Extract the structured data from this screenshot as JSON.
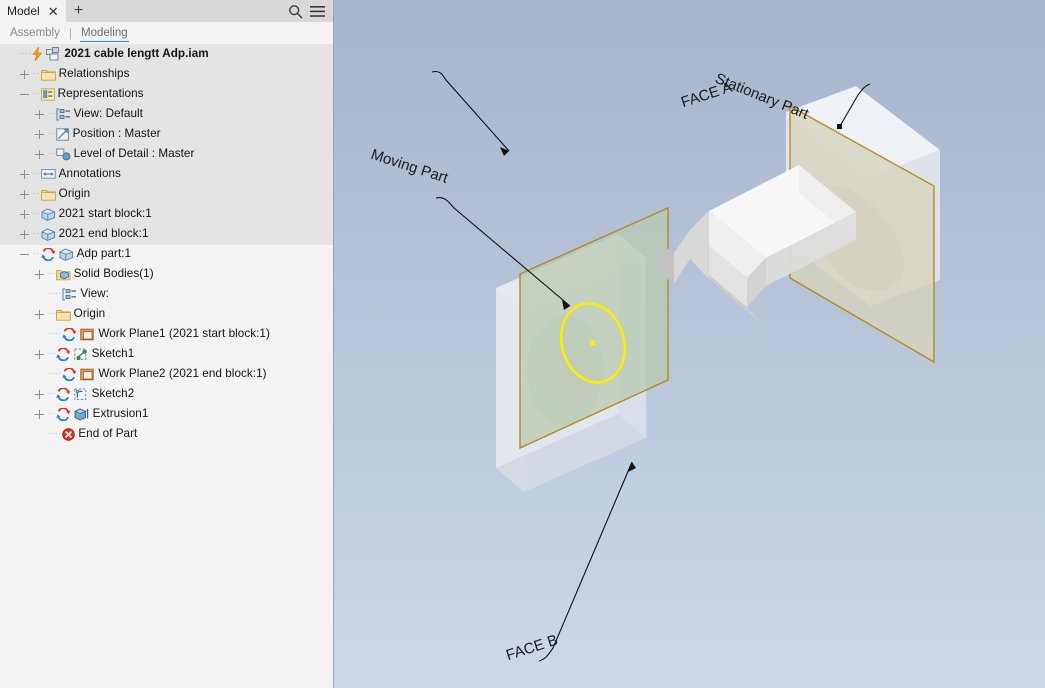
{
  "window": {
    "tab_title": "Model",
    "close_label": "✕",
    "add_label": "+",
    "search_icon": "search-icon",
    "menu_icon": "hamburger-menu-icon"
  },
  "subtabs": {
    "separator": "|",
    "items": [
      {
        "label": "Assembly",
        "active": false
      },
      {
        "label": "Modeling",
        "active": true
      }
    ]
  },
  "tree": {
    "rows": [
      {
        "label": "2021 cable lengtt Adp.iam",
        "indent": 0,
        "expander": "none",
        "icon": "assembly-icon",
        "bold": true,
        "lightning": true
      },
      {
        "label": "Relationships",
        "indent": 1,
        "expander": "plus",
        "icon": "folder-icon"
      },
      {
        "label": "Representations",
        "indent": 1,
        "expander": "minus",
        "icon": "representations-icon"
      },
      {
        "label": "View: Default",
        "indent": 2,
        "expander": "plus",
        "icon": "view-representation-icon"
      },
      {
        "label": "Position : Master",
        "indent": 2,
        "expander": "plus",
        "icon": "position-representation-icon"
      },
      {
        "label": "Level of Detail : Master",
        "indent": 2,
        "expander": "plus",
        "icon": "lod-representation-icon"
      },
      {
        "label": "Annotations",
        "indent": 1,
        "expander": "plus",
        "icon": "annotations-icon"
      },
      {
        "label": "Origin",
        "indent": 1,
        "expander": "plus",
        "icon": "folder-icon"
      },
      {
        "label": "2021 start block:1",
        "indent": 1,
        "expander": "plus",
        "icon": "part-icon"
      },
      {
        "label": "2021 end block:1",
        "indent": 1,
        "expander": "plus",
        "icon": "part-icon"
      },
      {
        "label": "Adp part:1",
        "indent": 1,
        "expander": "minus",
        "icon": "part-icon",
        "adaptive": true
      },
      {
        "label": "Solid Bodies(1)",
        "indent": 2,
        "expander": "plus",
        "icon": "solid-bodies-icon"
      },
      {
        "label": "View:",
        "indent": 2,
        "expander": "none",
        "icon": "view-representation-icon"
      },
      {
        "label": "Origin",
        "indent": 2,
        "expander": "plus",
        "icon": "folder-icon"
      },
      {
        "label": "Work Plane1 (2021 start block:1)",
        "indent": 2,
        "expander": "none",
        "icon": "work-plane-icon",
        "adaptive": true
      },
      {
        "label": "Sketch1",
        "indent": 2,
        "expander": "plus",
        "icon": "sketch-icon",
        "adaptive": true
      },
      {
        "label": "Work Plane2 (2021 end block:1)",
        "indent": 2,
        "expander": "none",
        "icon": "work-plane-icon",
        "adaptive": true
      },
      {
        "label": "Sketch2",
        "indent": 2,
        "expander": "plus",
        "icon": "sketch2-icon",
        "adaptive": true
      },
      {
        "label": "Extrusion1",
        "indent": 2,
        "expander": "plus",
        "icon": "extrusion-icon",
        "adaptive": true
      },
      {
        "label": "End of Part",
        "indent": 2,
        "expander": "none",
        "icon": "end-of-part-icon"
      }
    ]
  },
  "viewport": {
    "annotations": [
      {
        "text": "Moving Part",
        "name": "moving-part-label"
      },
      {
        "text": "FACE A",
        "name": "face-a-label"
      },
      {
        "text": "Stationary Part",
        "name": "stationary-part-label"
      },
      {
        "text": "FACE B",
        "name": "face-b-label"
      }
    ]
  },
  "colors": {
    "accent": "#2196d6",
    "work_plane_edge": "#b08a14",
    "green_plane": "#b8c9b0",
    "tan_plane": "#d6d2bd",
    "sketch_yellow": "#ffec00",
    "panel_bg": "#f3f3f3",
    "band": "#e4e4e4",
    "viewport_top": "#a7b5ce",
    "viewport_bottom": "#ccd7e8"
  }
}
